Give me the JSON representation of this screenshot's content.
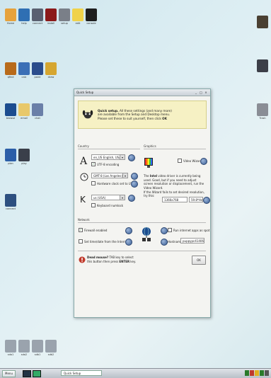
{
  "desktop": {
    "icons_top": [
      {
        "label": "Home",
        "color": "#e6a23c"
      },
      {
        "label": "help",
        "color": "#2f6fb3"
      },
      {
        "label": "connect",
        "color": "#5a6070"
      },
      {
        "label": "install",
        "color": "#8b1a1a"
      },
      {
        "label": "setup",
        "color": "#7a7f88"
      },
      {
        "label": "edit",
        "color": "#f0d24a"
      },
      {
        "label": "console",
        "color": "#1e1e1e"
      }
    ],
    "icons_row2": [
      {
        "label": "qfind",
        "color": "#b86a1a"
      },
      {
        "label": "calc",
        "color": "#3b6fb6"
      },
      {
        "label": "paint",
        "color": "#2a4c8c"
      },
      {
        "label": "draw",
        "color": "#d6a630"
      }
    ],
    "icons_row3": [
      {
        "label": "browse",
        "color": "#1b4c8f"
      },
      {
        "label": "email",
        "color": "#e8c86a"
      },
      {
        "label": "chat",
        "color": "#6a7fa8"
      }
    ],
    "icons_row4": [
      {
        "label": "plan",
        "color": "#2b5ea8"
      },
      {
        "label": "play",
        "color": "#3a3f4a"
      }
    ],
    "icons_row5": [
      {
        "label": "connect",
        "color": "#2d4f80"
      }
    ],
    "drive_icons": [
      {
        "label": "sda1"
      },
      {
        "label": "sda2"
      },
      {
        "label": "sdb1"
      },
      {
        "label": "sdb2"
      }
    ],
    "right_icons": [
      {
        "label": "",
        "color": "#4a4032"
      },
      {
        "label": "",
        "color": "#3c3f48"
      },
      {
        "label": "Trash",
        "color": "#8a8d95"
      }
    ]
  },
  "window": {
    "title": "Quick Setup",
    "controls": [
      "_",
      "□",
      "×"
    ],
    "banner": {
      "line1_bold": "Quick setup.",
      "line1_rest": " All these settings (and many more)",
      "line2": "are available from the Setup and Desktop menu.",
      "line3_pre": "Please set these to suit yourself, then click ",
      "line3_bold": "OK"
    },
    "country": {
      "title": "Country",
      "locale_value": "en_US    English, USA",
      "utf8_label": "UTF-8 encoding",
      "timezone_value": "GMT-8    (Los Angeles)",
      "hwclock_label": "Hardware clock set to UTC",
      "keyboard_value": "us        (USA)",
      "numlock_label": "Keyboard numlock"
    },
    "graphics": {
      "title": "Graphics",
      "video_wizard_label": "Video Wizard",
      "desc_pre": "The ",
      "desc_bold": "Intel",
      "desc_rest": " video driver is currently being used. Good, but if you need to adjust screen resolution or displacement, run the Video Wizard.",
      "resolution_text": "If the Wizard fails to set desired resolution, try this:",
      "resolution_value": "1366x768",
      "refresh_value": "59.8*Hz"
    },
    "network": {
      "title": "Network",
      "firewall_label": "Firewall enabled",
      "timedate_label": "Set time/date from the Internet",
      "run_internet_label": "Run internet apps as spot",
      "hostname_label": "Hostname",
      "hostname_value": "puppypc41406"
    },
    "footer": {
      "pre": "",
      "bold": "Dead mouse?",
      "rest": " TAB key to select",
      "line2_pre": "this button then press ",
      "line2_bold": "ENTER",
      "line2_rest": " key.",
      "ok_label": "OK"
    }
  },
  "taskbar": {
    "menu_label": "Menu",
    "task_label": "Quick Setup",
    "tray_colors": [
      "#2a7a2a",
      "#c0392b",
      "#e0b020",
      "#2a7a2a",
      "#555"
    ]
  }
}
